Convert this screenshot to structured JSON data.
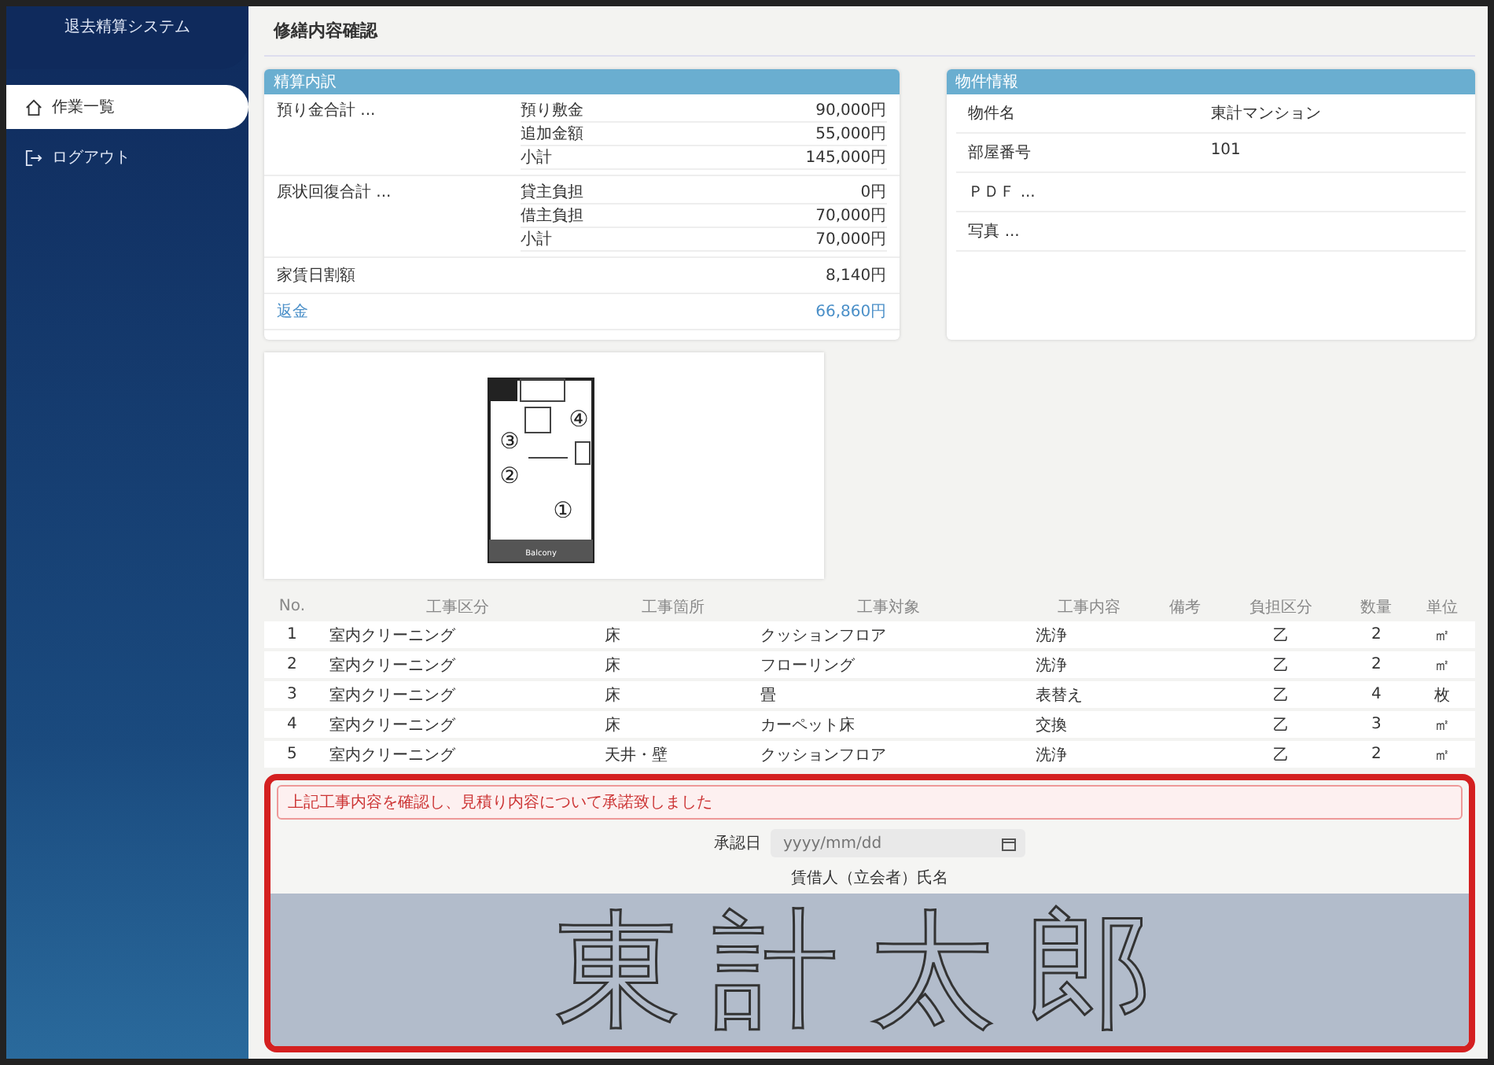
{
  "sidebar": {
    "app_title": "退去精算システム",
    "items": [
      {
        "label": "作業一覧",
        "selected": true
      },
      {
        "label": "ログアウト",
        "selected": false
      }
    ]
  },
  "page_title": "修繕内容確認",
  "cost_card": {
    "title": "精算内訳",
    "groups": [
      {
        "label": "預り金合計 ...",
        "lines": [
          {
            "label": "預り敷金",
            "value": "90,000円"
          },
          {
            "label": "追加金額",
            "value": "55,000円"
          },
          {
            "label": "小計",
            "value": "145,000円"
          }
        ]
      },
      {
        "label": "原状回復合計 ...",
        "lines": [
          {
            "label": "貸主負担",
            "value": "0円"
          },
          {
            "label": "借主負担",
            "value": "70,000円"
          },
          {
            "label": "小計",
            "value": "70,000円"
          }
        ]
      }
    ],
    "rent_label": "家賃日割額",
    "rent_value": "8,140円",
    "total_label": "返金",
    "total_value": "66,860円"
  },
  "property_card": {
    "title": "物件情報",
    "rows": [
      {
        "label": "物件名",
        "value": "東計マンション"
      },
      {
        "label": "部屋番号",
        "value": "101"
      },
      {
        "label": "ＰＤＦ ...",
        "value": ""
      },
      {
        "label": "写真 ...",
        "value": ""
      }
    ]
  },
  "floor_plan": {
    "markers": [
      "①",
      "②",
      "③",
      "④"
    ],
    "labels": [
      "Balcony"
    ]
  },
  "table": {
    "columns": [
      "No.",
      "工事区分",
      "工事箇所",
      "工事対象",
      "工事内容",
      "備考",
      "負担区分",
      "数量",
      "単位"
    ],
    "rows": [
      [
        "1",
        "室内クリーニング",
        "床",
        "クッションフロア",
        "洗浄",
        "",
        "乙",
        "2",
        "㎡"
      ],
      [
        "2",
        "室内クリーニング",
        "床",
        "フローリング",
        "洗浄",
        "",
        "乙",
        "2",
        "㎡"
      ],
      [
        "3",
        "室内クリーニング",
        "床",
        "畳",
        "表替え",
        "",
        "乙",
        "4",
        "枚"
      ],
      [
        "4",
        "室内クリーニング",
        "床",
        "カーペット床",
        "交換",
        "",
        "乙",
        "3",
        "㎡"
      ],
      [
        "5",
        "室内クリーニング",
        "天井・壁",
        "クッションフロア",
        "洗浄",
        "",
        "乙",
        "2",
        "㎡"
      ]
    ]
  },
  "approval": {
    "notice": "上記工事内容を確認し、見積り内容について承諾致しました",
    "date_label": "承認日",
    "date_placeholder": "yyyy/mm/dd",
    "signer_label": "賃借人（立会者）氏名",
    "signature": "東計太郎"
  }
}
